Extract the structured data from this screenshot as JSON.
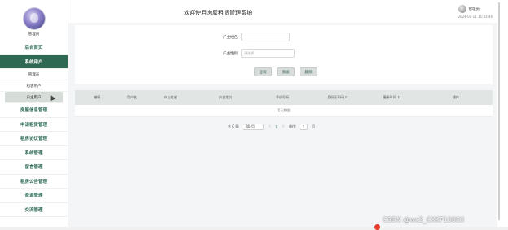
{
  "sidebar": {
    "user_name": "管理员",
    "items": [
      {
        "label": "后台首页"
      },
      {
        "label": "系统用户"
      },
      {
        "label": "房屋信息管理"
      },
      {
        "label": "申请租赁管理"
      },
      {
        "label": "租房协议管理"
      },
      {
        "label": "系统管理"
      },
      {
        "label": "留言管理"
      },
      {
        "label": "租房公告管理"
      },
      {
        "label": "资源管理"
      },
      {
        "label": "交流管理"
      }
    ],
    "sub_items": [
      {
        "label": "管理员"
      },
      {
        "label": "租客用户"
      },
      {
        "label": "户主用户"
      }
    ]
  },
  "header": {
    "title": "欢迎使用房屋租赁管理系统",
    "admin_name": "管理员",
    "admin_time": "2024-01-11 11:43:46"
  },
  "search": {
    "name_label": "户主姓名",
    "name_placeholder": "",
    "gender_label": "户主性别",
    "gender_placeholder": "请选择",
    "query_button": "查询",
    "add_button": "添加",
    "delete_button": "删除"
  },
  "table": {
    "columns": [
      "编码",
      "用户名",
      "户主姓名",
      "户主性别",
      "手机号码",
      "身份证号码 ⇕",
      "更新时间 ⇕",
      "操作"
    ],
    "empty_text": "暂无数据"
  },
  "pagination": {
    "total": "共 0 条",
    "page_size": "7条/页",
    "current_page": "1",
    "goto_label": "前往",
    "goto_value": "1",
    "page_suffix": "页",
    "prev": "<",
    "next": ">"
  },
  "watermark": "CSDN @wx2_CXKF10083",
  "colors": {
    "accent": "#2e6a53",
    "table_header": "#e1e6e4",
    "main_bg": "#f4f5f7"
  }
}
